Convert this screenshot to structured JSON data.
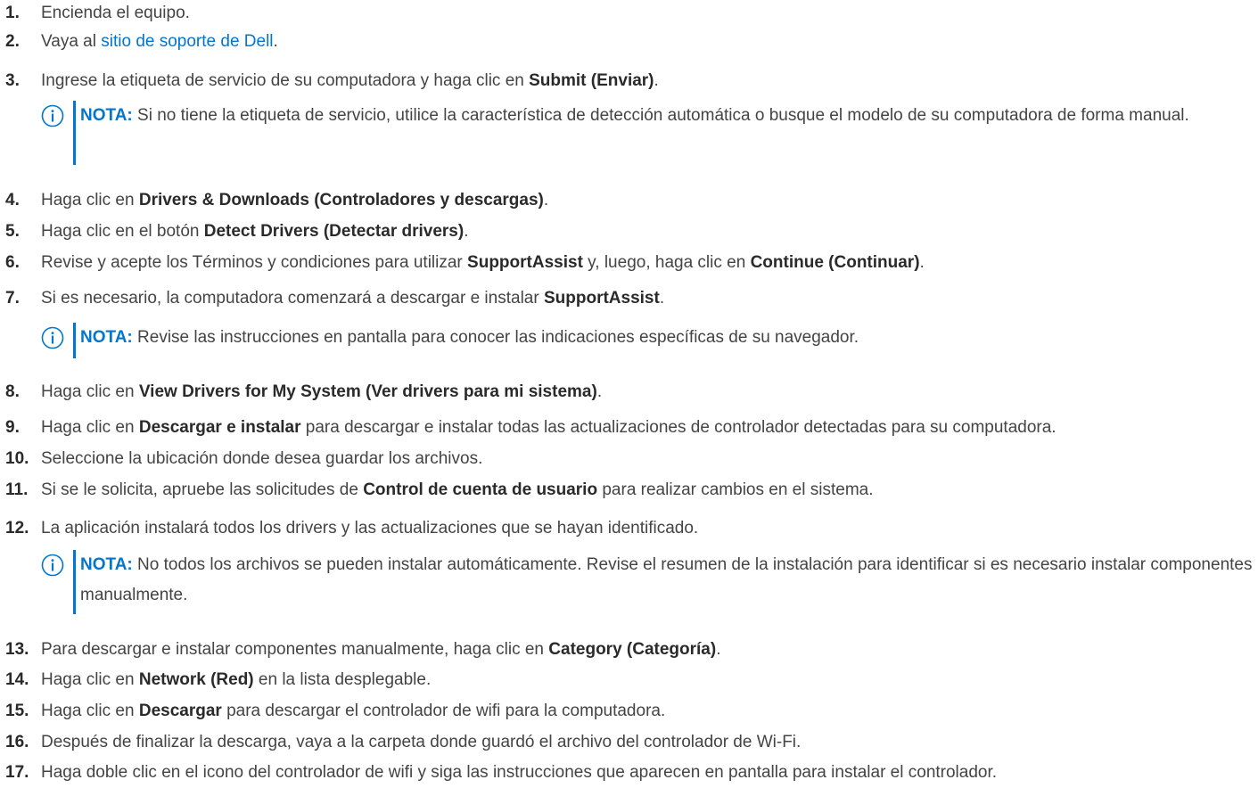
{
  "steps": [
    {
      "num": "1.",
      "a": "Encienda el equipo."
    },
    {
      "num": "2.",
      "a": "Vaya al ",
      "link": "sitio de soporte de Dell",
      "b": "."
    },
    {
      "num": "3.",
      "a": "Ingrese la etiqueta de servicio de su computadora y haga clic en ",
      "bold": "Submit (Enviar)",
      "b": "."
    },
    {
      "num": "4.",
      "a": "Haga clic en ",
      "bold": "Drivers & Downloads (Controladores y descargas)",
      "b": "."
    },
    {
      "num": "5.",
      "a": "Haga clic en el botón ",
      "bold": "Detect Drivers (Detectar drivers)",
      "b": "."
    },
    {
      "num": "6.",
      "a": "Revise y acepte los Términos y condiciones para utilizar ",
      "bold": "SupportAssist",
      "b": " y, luego, haga clic en ",
      "bold2": "Continue (Continuar)",
      "c": "."
    },
    {
      "num": "7.",
      "a": "Si es necesario, la computadora comenzará a descargar e instalar ",
      "bold": "SupportAssist",
      "b": "."
    },
    {
      "num": "8.",
      "a": "Haga clic en ",
      "bold": "View Drivers for My System (Ver drivers para mi sistema)",
      "b": "."
    },
    {
      "num": "9.",
      "a": "Haga clic en ",
      "bold": "Descargar e instalar",
      "b": " para descargar e instalar todas las actualizaciones de controlador detectadas para su computadora."
    },
    {
      "num": "10.",
      "a": "Seleccione la ubicación donde desea guardar los archivos."
    },
    {
      "num": "11.",
      "a": "Si se le solicita, apruebe las solicitudes de ",
      "bold": "Control de cuenta de usuario",
      "b": " para realizar cambios en el sistema."
    },
    {
      "num": "12.",
      "a": "La aplicación instalará todos los drivers y las actualizaciones que se hayan identificado."
    },
    {
      "num": "13.",
      "a": "Para descargar e instalar componentes manualmente, haga clic en ",
      "bold": "Category (Categoría)",
      "b": "."
    },
    {
      "num": "14.",
      "a": "Haga clic en ",
      "bold": "Network (Red)",
      "b": " en la lista desplegable."
    },
    {
      "num": "15.",
      "a": "Haga clic en ",
      "bold": "Descargar",
      "b": " para descargar el controlador de wifi para la computadora."
    },
    {
      "num": "16.",
      "a": "Después de finalizar la descarga, vaya a la carpeta donde guardó el archivo del controlador de Wi-Fi."
    },
    {
      "num": "17.",
      "a": "Haga doble clic en el icono del controlador de wifi y siga las instrucciones que aparecen en pantalla para instalar el controlador."
    }
  ],
  "notes": [
    {
      "label": "NOTA:",
      "text": " Si no tiene la etiqueta de servicio, utilice la característica de detección automática o busque el modelo de su computadora de forma manual."
    },
    {
      "label": "NOTA:",
      "text": " Revise las instrucciones en pantalla para conocer las indicaciones específicas de su navegador."
    },
    {
      "label": "NOTA:",
      "text": " No todos los archivos se pueden instalar automáticamente. Revise el resumen de la instalación para identificar si es necesario instalar componentes manualmente."
    }
  ],
  "colors": {
    "accent": "#0076ce",
    "text": "#444444"
  },
  "icons": {
    "note": "info-circle-icon"
  }
}
